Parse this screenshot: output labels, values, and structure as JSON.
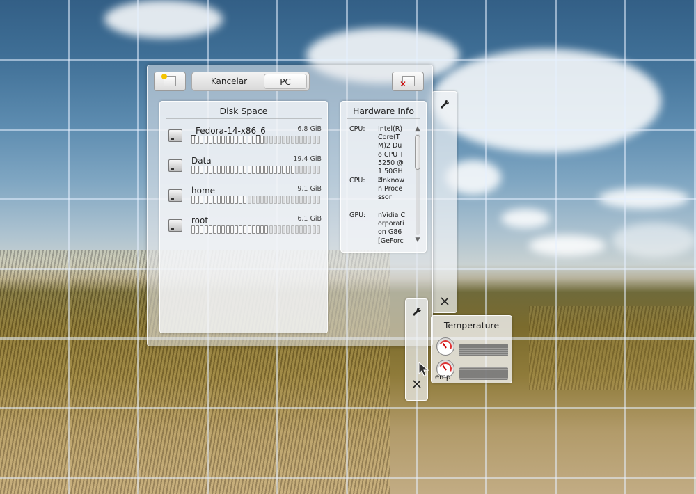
{
  "desktop": {
    "wallpaper_description_hidden": ""
  },
  "container": {
    "tabs": [
      {
        "label": "Kancelar",
        "active": false
      },
      {
        "label": "PC",
        "active": true
      }
    ]
  },
  "disk_space": {
    "title": "Disk Space",
    "disks": [
      {
        "name": "_Fedora-14-x86_6",
        "size": "6.8 GiB",
        "fill": 0.55
      },
      {
        "name": "Data",
        "size": "19.4 GiB",
        "fill": 0.8
      },
      {
        "name": "home",
        "size": "9.1 GiB",
        "fill": 0.42
      },
      {
        "name": "root",
        "size": "6.1 GiB",
        "fill": 0.6
      }
    ]
  },
  "hardware_info": {
    "title": "Hardware Info",
    "rows": [
      {
        "key": "CPU:",
        "value": "Intel(R) Core(TM)2 Duo CPU T5250 @ 1.50GHz"
      },
      {
        "key": "CPU:",
        "value": "Unknown Processor"
      },
      {
        "key": "GPU:",
        "value": "nVidia Corporation G86 [GeForc"
      }
    ]
  },
  "temperature": {
    "title": "Temperature",
    "sensors": [
      {
        "label": ""
      },
      {
        "label": "emp"
      }
    ]
  },
  "icons": {
    "add_activity": "new-activity-icon",
    "remove_activity": "remove-activity-icon",
    "configure": "wrench-icon",
    "close": "close-icon"
  }
}
